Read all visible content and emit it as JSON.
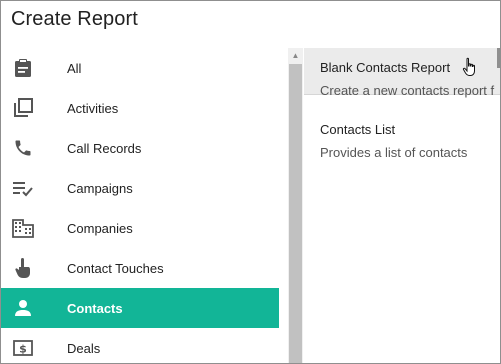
{
  "dialog": {
    "title": "Create Report"
  },
  "categories": [
    {
      "label": "All",
      "icon": "clipboard-icon"
    },
    {
      "label": "Activities",
      "icon": "activities-icon"
    },
    {
      "label": "Call Records",
      "icon": "phone-icon"
    },
    {
      "label": "Campaigns",
      "icon": "campaigns-icon"
    },
    {
      "label": "Companies",
      "icon": "building-icon"
    },
    {
      "label": "Contact Touches",
      "icon": "touch-icon"
    },
    {
      "label": "Contacts",
      "icon": "person-icon"
    },
    {
      "label": "Deals",
      "icon": "dollar-icon"
    }
  ],
  "selected_category": "Contacts",
  "reports": [
    {
      "title": "Blank Contacts Report",
      "description": "Create a new contacts report f"
    },
    {
      "title": "Contacts List",
      "description": "Provides a list of contacts"
    }
  ],
  "colors": {
    "accent": "#12b597",
    "hover": "#ebebeb"
  }
}
